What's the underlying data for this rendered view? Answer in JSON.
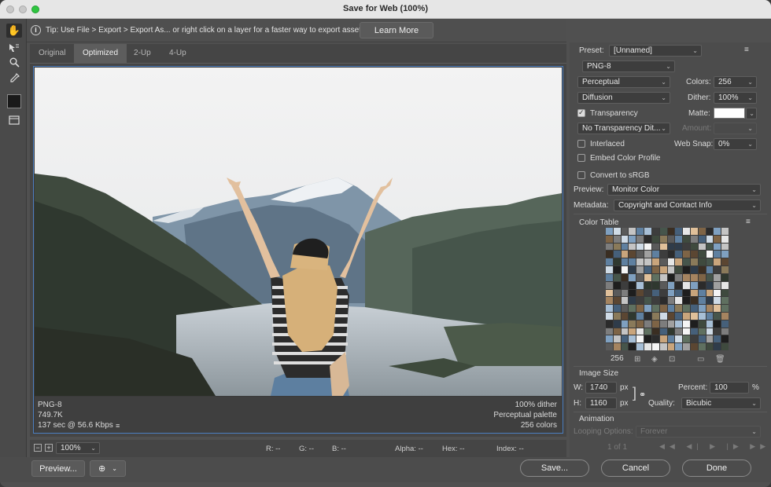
{
  "window": {
    "title": "Save for Web (100%)"
  },
  "tip": {
    "text": "Tip: Use File > Export > Export As...  or right click on a layer for a faster way to export assets",
    "learn_more": "Learn More"
  },
  "tabs": [
    "Original",
    "Optimized",
    "2-Up",
    "4-Up"
  ],
  "active_tab": "Optimized",
  "image_info": {
    "left": [
      "PNG-8",
      "749.7K",
      "137 sec @ 56.6 Kbps"
    ],
    "right": [
      "100% dither",
      "Perceptual palette",
      "256 colors"
    ]
  },
  "status": {
    "zoom": "100%",
    "r": "R: --",
    "g": "G: --",
    "b": "B: --",
    "alpha": "Alpha: --",
    "hex": "Hex: --",
    "index": "Index: --"
  },
  "buttons": {
    "preview": "Preview...",
    "save": "Save...",
    "cancel": "Cancel",
    "done": "Done"
  },
  "settings": {
    "preset_label": "Preset:",
    "preset_value": "[Unnamed]",
    "format": "PNG-8",
    "reduction": "Perceptual",
    "colors_label": "Colors:",
    "colors_value": "256",
    "dither_algo": "Diffusion",
    "dither_label": "Dither:",
    "dither_value": "100%",
    "transparency_label": "Transparency",
    "transparency_checked": true,
    "matte_label": "Matte:",
    "transparency_dither": "No Transparency Dit...",
    "amount_label": "Amount:",
    "interlaced_label": "Interlaced",
    "websnap_label": "Web Snap:",
    "websnap_value": "0%",
    "embed_label": "Embed Color Profile",
    "srgb_label": "Convert to sRGB",
    "preview_label": "Preview:",
    "preview_value": "Monitor Color",
    "metadata_label": "Metadata:",
    "metadata_value": "Copyright and Contact Info",
    "color_table_label": "Color Table",
    "color_count": "256"
  },
  "image_size": {
    "label": "Image Size",
    "w_label": "W:",
    "w_value": "1740",
    "w_unit": "px",
    "h_label": "H:",
    "h_value": "1160",
    "h_unit": "px",
    "percent_label": "Percent:",
    "percent_value": "100",
    "percent_unit": "%",
    "quality_label": "Quality:",
    "quality_value": "Bicubic"
  },
  "animation": {
    "label": "Animation",
    "looping_label": "Looping Options:",
    "looping_value": "Forever",
    "frame_counter": "1 of 1"
  },
  "colors": {
    "accent": "#4c7fc1",
    "panel": "#4c4c4c",
    "title_bg": "#e6e6e6"
  },
  "icons": [
    "hand-icon",
    "slice-select-icon",
    "zoom-icon",
    "eyedropper-icon",
    "eyedropper-color-icon",
    "toggle-slices-icon",
    "info-icon",
    "panel-menu-icon",
    "link-icon",
    "browser-icon",
    "chevron-down-icon"
  ]
}
